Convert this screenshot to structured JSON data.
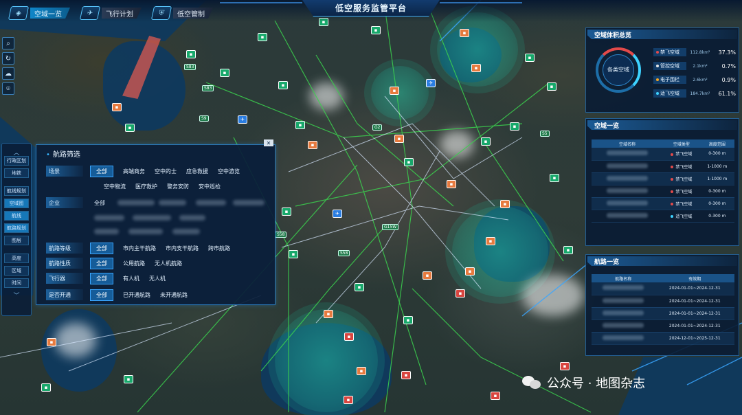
{
  "header": {
    "title": "低空服务监管平台",
    "tabs": [
      {
        "label": "空域一览",
        "active": true
      },
      {
        "label": "飞行计划",
        "active": false
      },
      {
        "label": "低空管制",
        "active": false
      }
    ]
  },
  "toolbar": {
    "icons": [
      "search-icon",
      "refresh-icon",
      "weather-icon",
      "location-icon"
    ]
  },
  "side_menu": {
    "top_items": [
      "行政区划",
      "地铁"
    ],
    "mid_items": [
      "航线规划",
      "空域图",
      "航线",
      "航路规划",
      "图层"
    ],
    "bottom_items": [
      "高度",
      "区域",
      "时间"
    ]
  },
  "route_filter": {
    "title": "航路筛选",
    "close_label": "✕",
    "scene": {
      "label": "场景",
      "options": [
        "全部",
        "高端商务",
        "空中的士",
        "应急救援",
        "空中游览"
      ],
      "options_row2": [
        "空中物流",
        "医疗救护",
        "警务安防",
        "安中巡检"
      ],
      "selected": "全部"
    },
    "enterprise": {
      "label": "企业",
      "options": [
        "全部"
      ]
    },
    "route_level": {
      "label": "航路等级",
      "options": [
        "全部",
        "市内主干航路",
        "市内支干航路",
        "跨市航路"
      ],
      "selected": "全部"
    },
    "route_nature": {
      "label": "航路性质",
      "options": [
        "全部",
        "公用航路",
        "无人机航路"
      ],
      "selected": "全部"
    },
    "aircraft": {
      "label": "飞行器",
      "options": [
        "全部",
        "有人机",
        "无人机"
      ],
      "selected": "全部"
    },
    "opened": {
      "label": "是否开通",
      "options": [
        "全部",
        "已开通航路",
        "未开通航路"
      ],
      "selected": "全部"
    }
  },
  "airspace_stats": {
    "title": "空域体积总览",
    "center_label": "各类空域",
    "rows": [
      {
        "label": "禁飞空域",
        "area": "112.8km²",
        "percent": "37.3%",
        "color": "#e24a4a"
      },
      {
        "label": "管控空域",
        "area": "2.1km²",
        "percent": "0.7%",
        "color": "#e6e6e6"
      },
      {
        "label": "电子围栏",
        "area": "2.6km²",
        "percent": "0.9%",
        "color": "#f5a623"
      },
      {
        "label": "适飞空域",
        "area": "184.7km²",
        "percent": "61.1%",
        "color": "#3dd2ff"
      }
    ]
  },
  "airspace_list": {
    "title": "空域一览",
    "columns": [
      "空域名称",
      "空域类型",
      "高度范围"
    ],
    "rows": [
      {
        "type": "禁飞空域",
        "height": "0-300 m",
        "color": "#e24a4a"
      },
      {
        "type": "禁飞空域",
        "height": "1-1000 m",
        "color": "#e24a4a"
      },
      {
        "type": "禁飞空域",
        "height": "1-1000 m",
        "color": "#e24a4a"
      },
      {
        "type": "禁飞空域",
        "height": "0-300 m",
        "color": "#e24a4a"
      },
      {
        "type": "禁飞空域",
        "height": "0-300 m",
        "color": "#e24a4a"
      },
      {
        "type": "适飞空域",
        "height": "0-300 m",
        "color": "#3dd2ff"
      }
    ]
  },
  "route_list": {
    "title": "航路一览",
    "columns": [
      "航路名称",
      "有效期"
    ],
    "rows": [
      {
        "validity": "2024-01-01~2024-12-31"
      },
      {
        "validity": "2024-01-01~2024-12-31"
      },
      {
        "validity": "2024-01-01~2024-12-31"
      },
      {
        "validity": "2024-01-01~2024-12-31"
      },
      {
        "validity": "2024-12-01~2025-12-31"
      }
    ]
  },
  "map": {
    "road_badges": [
      "S83",
      "S83",
      "S9",
      "G2",
      "S5",
      "G15W",
      "S58",
      "S58"
    ]
  },
  "watermark": {
    "text": "公众号 · 地图杂志"
  }
}
